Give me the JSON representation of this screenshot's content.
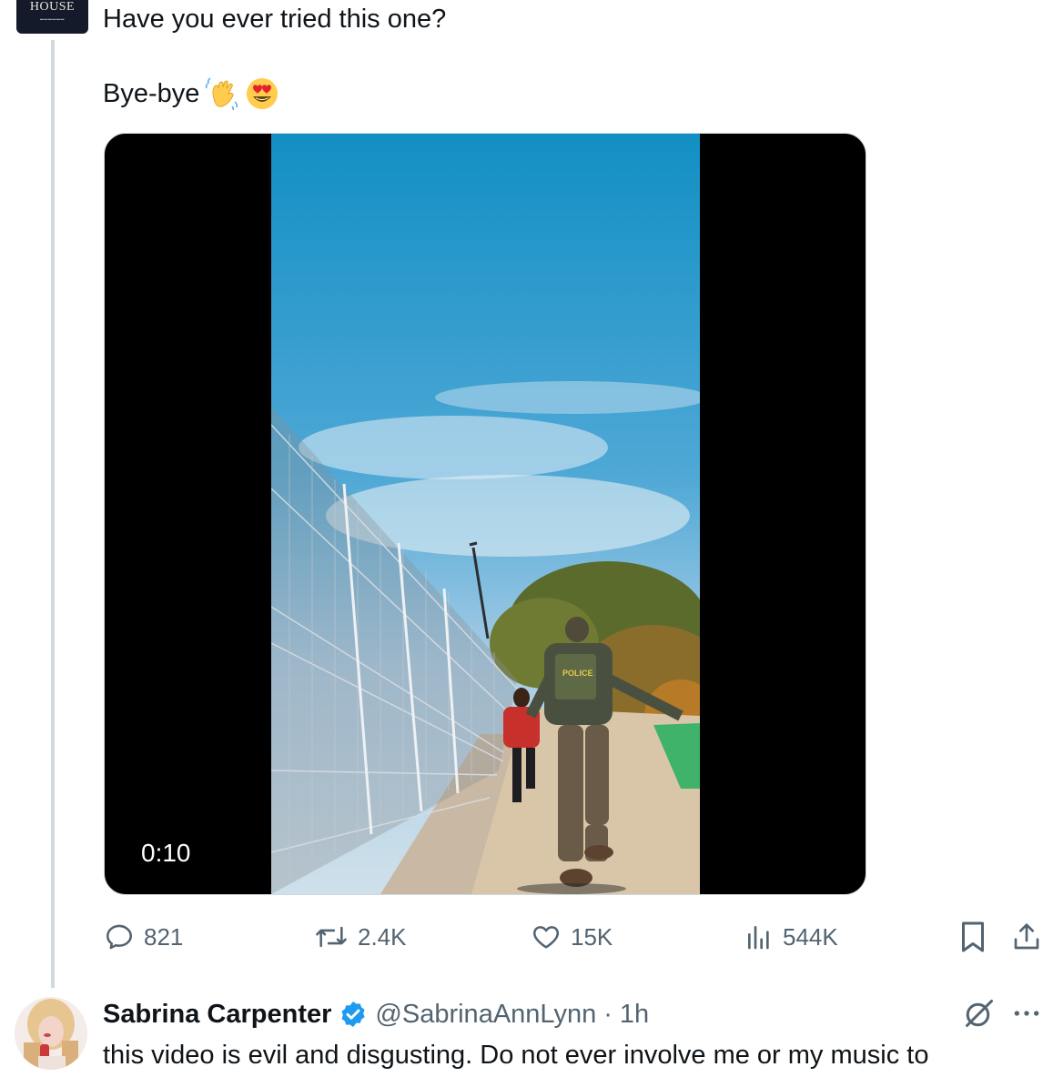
{
  "tweet": {
    "avatar_logo": "HOUSE",
    "text_line1": "Have you ever tried this one?",
    "text_line2": "Bye-bye",
    "emojis": [
      "waving-hand",
      "heart-eyes"
    ],
    "video": {
      "duration": "0:10",
      "vest_text": "POLICE"
    },
    "actions": {
      "replies": "821",
      "reposts": "2.4K",
      "likes": "15K",
      "views": "544K"
    }
  },
  "reply": {
    "name": "Sabrina Carpenter",
    "verified": true,
    "handle": "@SabrinaAnnLynn",
    "separator": "·",
    "time": "1h",
    "text": "this video is evil and disgusting. Do not ever involve me or my music to"
  },
  "colors": {
    "text": "#0f1419",
    "secondary": "#536471",
    "verified_blue": "#1d9bf0",
    "thread_line": "#cfd9de"
  }
}
